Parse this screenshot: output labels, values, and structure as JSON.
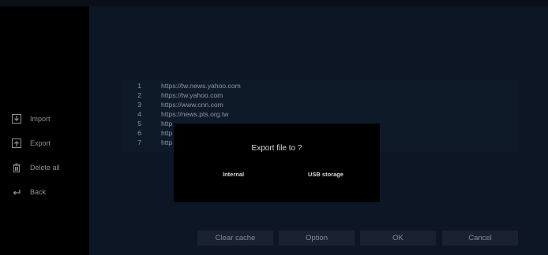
{
  "sidebar": {
    "items": [
      {
        "label": "Import",
        "icon": "import-icon"
      },
      {
        "label": "Export",
        "icon": "export-icon"
      },
      {
        "label": "Delete all",
        "icon": "trash-icon"
      },
      {
        "label": "Back",
        "icon": "back-arrow-icon"
      }
    ]
  },
  "url_list": {
    "rows": [
      {
        "num": "1",
        "url": "https://tw.news.yahoo.com"
      },
      {
        "num": "2",
        "url": "https://tw.yahoo.com"
      },
      {
        "num": "3",
        "url": "https://www.cnn.com"
      },
      {
        "num": "4",
        "url": "https://news.pts.org.tw"
      },
      {
        "num": "5",
        "url": "http"
      },
      {
        "num": "6",
        "url": "http"
      },
      {
        "num": "7",
        "url": "http"
      }
    ]
  },
  "dialog": {
    "title": "Export file to ?",
    "options": [
      "Internal",
      "USB storage"
    ]
  },
  "buttons": {
    "clear_cache": "Clear cache",
    "option": "Option",
    "ok": "OK",
    "cancel": "Cancel"
  }
}
